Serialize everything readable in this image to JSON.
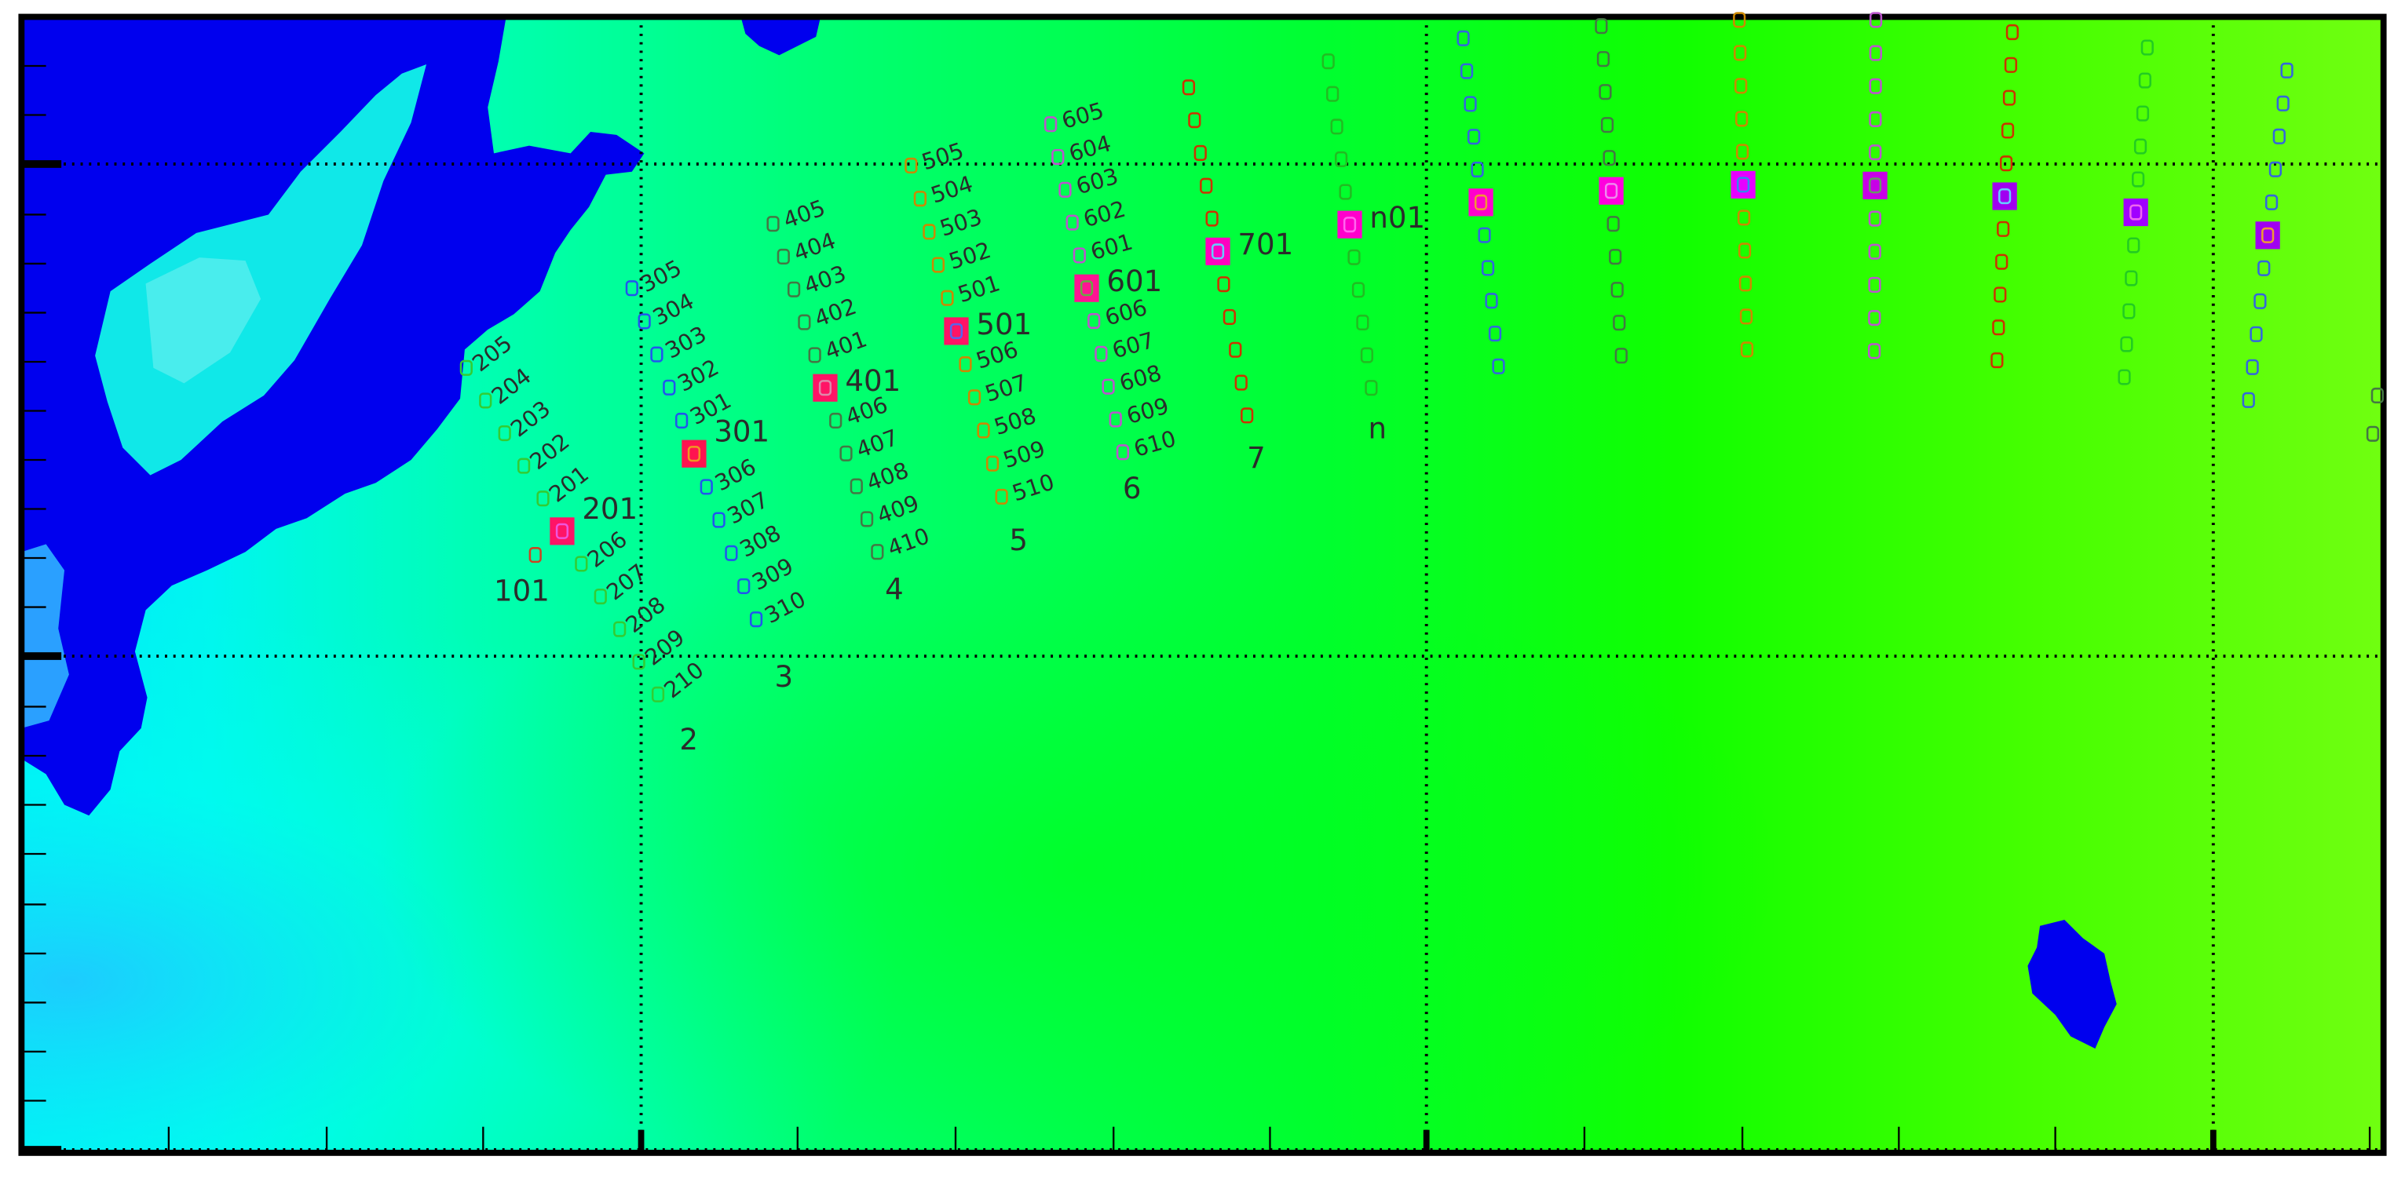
{
  "map": {
    "background_colors": {
      "low": "#0000ee",
      "mid_low": "#00f0ff",
      "mid": "#00ff40",
      "high": "#70ff00"
    },
    "extra_site": {
      "label": "101",
      "color": "#cc4422"
    },
    "lines": [
      {
        "name": "2",
        "color": "#33cc33",
        "big_color": "#ff1466",
        "big_inner": "#ee55dd",
        "big_label": "201",
        "labels": [
          "205",
          "204",
          "203",
          "202",
          "201",
          "206",
          "207",
          "208",
          "209",
          "210"
        ],
        "line_label": "2"
      },
      {
        "name": "3",
        "color": "#2255ee",
        "big_color": "#ff1450",
        "big_inner": "#ee9922",
        "big_label": "301",
        "labels": [
          "305",
          "304",
          "303",
          "302",
          "301",
          "306",
          "307",
          "308",
          "309",
          "310"
        ],
        "line_label": "3"
      },
      {
        "name": "4",
        "color": "#447744",
        "big_color": "#ff1466",
        "big_inner": "#dd88aa",
        "big_label": "401",
        "labels": [
          "405",
          "404",
          "403",
          "402",
          "401",
          "406",
          "407",
          "408",
          "409",
          "410"
        ],
        "line_label": "4"
      },
      {
        "name": "5",
        "color": "#cc8800",
        "big_color": "#ff1466",
        "big_inner": "#5566ee",
        "big_label": "501",
        "labels": [
          "505",
          "504",
          "503",
          "502",
          "501",
          "506",
          "507",
          "508",
          "509",
          "510"
        ],
        "line_label": "5"
      },
      {
        "name": "6",
        "color": "#bb55cc",
        "big_color": "#ff1493",
        "big_inner": "#66aa44",
        "big_label": "601",
        "labels": [
          "605",
          "604",
          "603",
          "602",
          "601",
          "606",
          "607",
          "608",
          "609",
          "610"
        ],
        "line_label": "6"
      },
      {
        "name": "7",
        "color": "#cc3300",
        "big_color": "#ff00c0",
        "big_inner": "#66ccff",
        "big_label": "701",
        "labels": [],
        "line_label": "7"
      },
      {
        "name": "n",
        "color": "#22bb22",
        "big_color": "#ff00cc",
        "big_inner": "#ff66ee",
        "big_label": "n01",
        "labels": [],
        "line_label": "n"
      },
      {
        "name": "c8",
        "color": "#3366dd",
        "big_color": "#ff00cc",
        "big_inner": "#ee9933",
        "big_label": "",
        "labels": [],
        "line_label": ""
      },
      {
        "name": "c9",
        "color": "#447744",
        "big_color": "#ff00dd",
        "big_inner": "#ee88ee",
        "big_label": "",
        "labels": [],
        "line_label": ""
      },
      {
        "name": "c10",
        "color": "#cc8800",
        "big_color": "#e600ff",
        "big_inner": "#3388ee",
        "big_label": "",
        "labels": [],
        "line_label": ""
      },
      {
        "name": "c11",
        "color": "#bb55cc",
        "big_color": "#c800e6",
        "big_inner": "#669966",
        "big_label": "",
        "labels": [],
        "line_label": ""
      },
      {
        "name": "c12",
        "color": "#cc3300",
        "big_color": "#a000f0",
        "big_inner": "#66ccff",
        "big_label": "",
        "labels": [],
        "line_label": ""
      },
      {
        "name": "c13",
        "color": "#22cc22",
        "big_color": "#a000ff",
        "big_inner": "#ee66ee",
        "big_label": "",
        "labels": [],
        "line_label": ""
      },
      {
        "name": "c14",
        "color": "#3366dd",
        "big_color": "#a000f0",
        "big_inner": "#ee9933",
        "big_label": "",
        "labels": [],
        "line_label": ""
      }
    ]
  }
}
